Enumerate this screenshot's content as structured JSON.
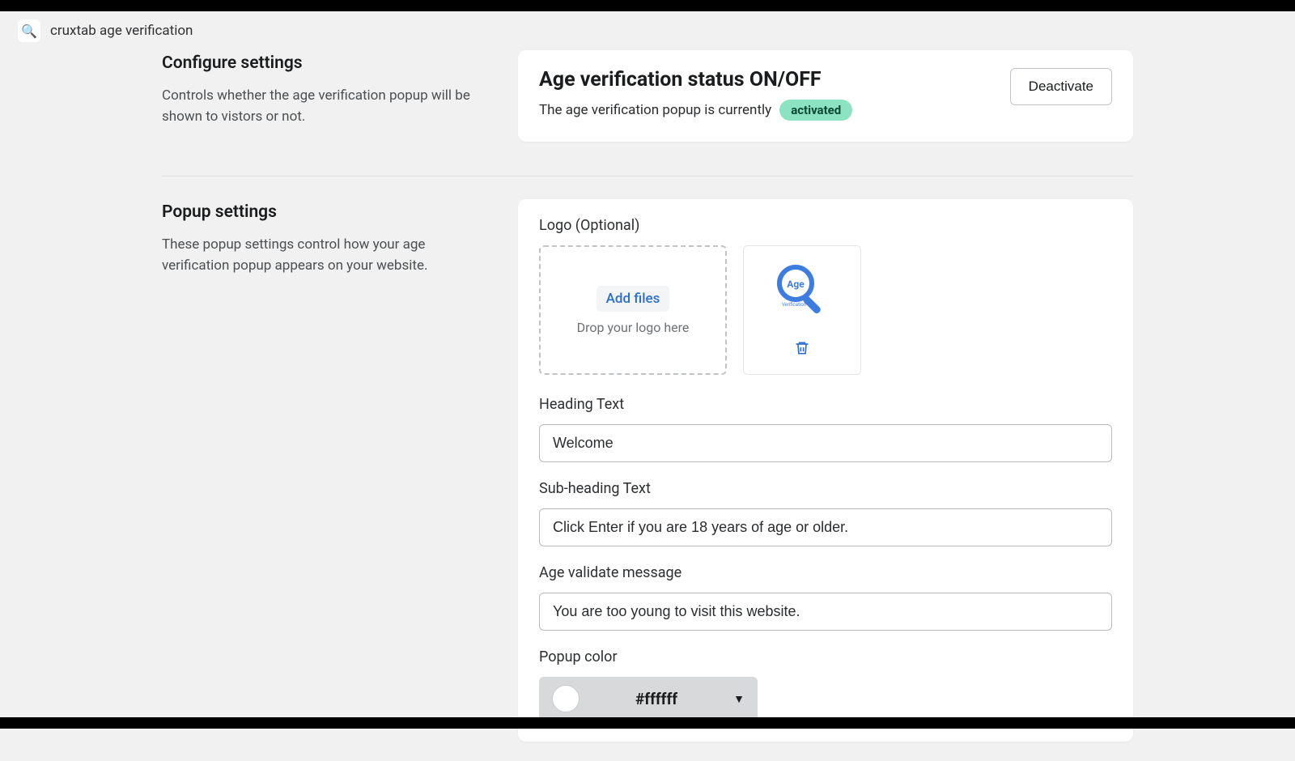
{
  "breadcrumb": {
    "icon": "🔍",
    "text": "cruxtab age verification"
  },
  "sections": {
    "configure": {
      "title": "Configure settings",
      "desc": "Controls whether the age verification popup will be shown to vistors or not."
    },
    "popup": {
      "title": "Popup settings",
      "desc": "These popup settings control how your age verification popup appears on your website."
    }
  },
  "status": {
    "title": "Age verification status ON/OFF",
    "line_prefix": "The age verification popup is currently",
    "badge": "activated",
    "deactivate_label": "Deactivate"
  },
  "popup_card": {
    "logo_label": "Logo (Optional)",
    "add_files": "Add files",
    "drop_hint": "Drop your logo here",
    "preview_badge_text": "Age",
    "preview_sub_text": "Verification",
    "heading_label": "Heading Text",
    "heading_value": "Welcome",
    "subheading_label": "Sub-heading Text",
    "subheading_value": "Click Enter if you are 18 years of age or older.",
    "validate_label": "Age validate message",
    "validate_value": "You are too young to visit this website.",
    "popup_color_label": "Popup color",
    "popup_color_value": "#ffffff"
  },
  "colors": {
    "badge_bg": "#8be3c2",
    "link": "#2c6ecb",
    "swatch": "#ffffff"
  }
}
